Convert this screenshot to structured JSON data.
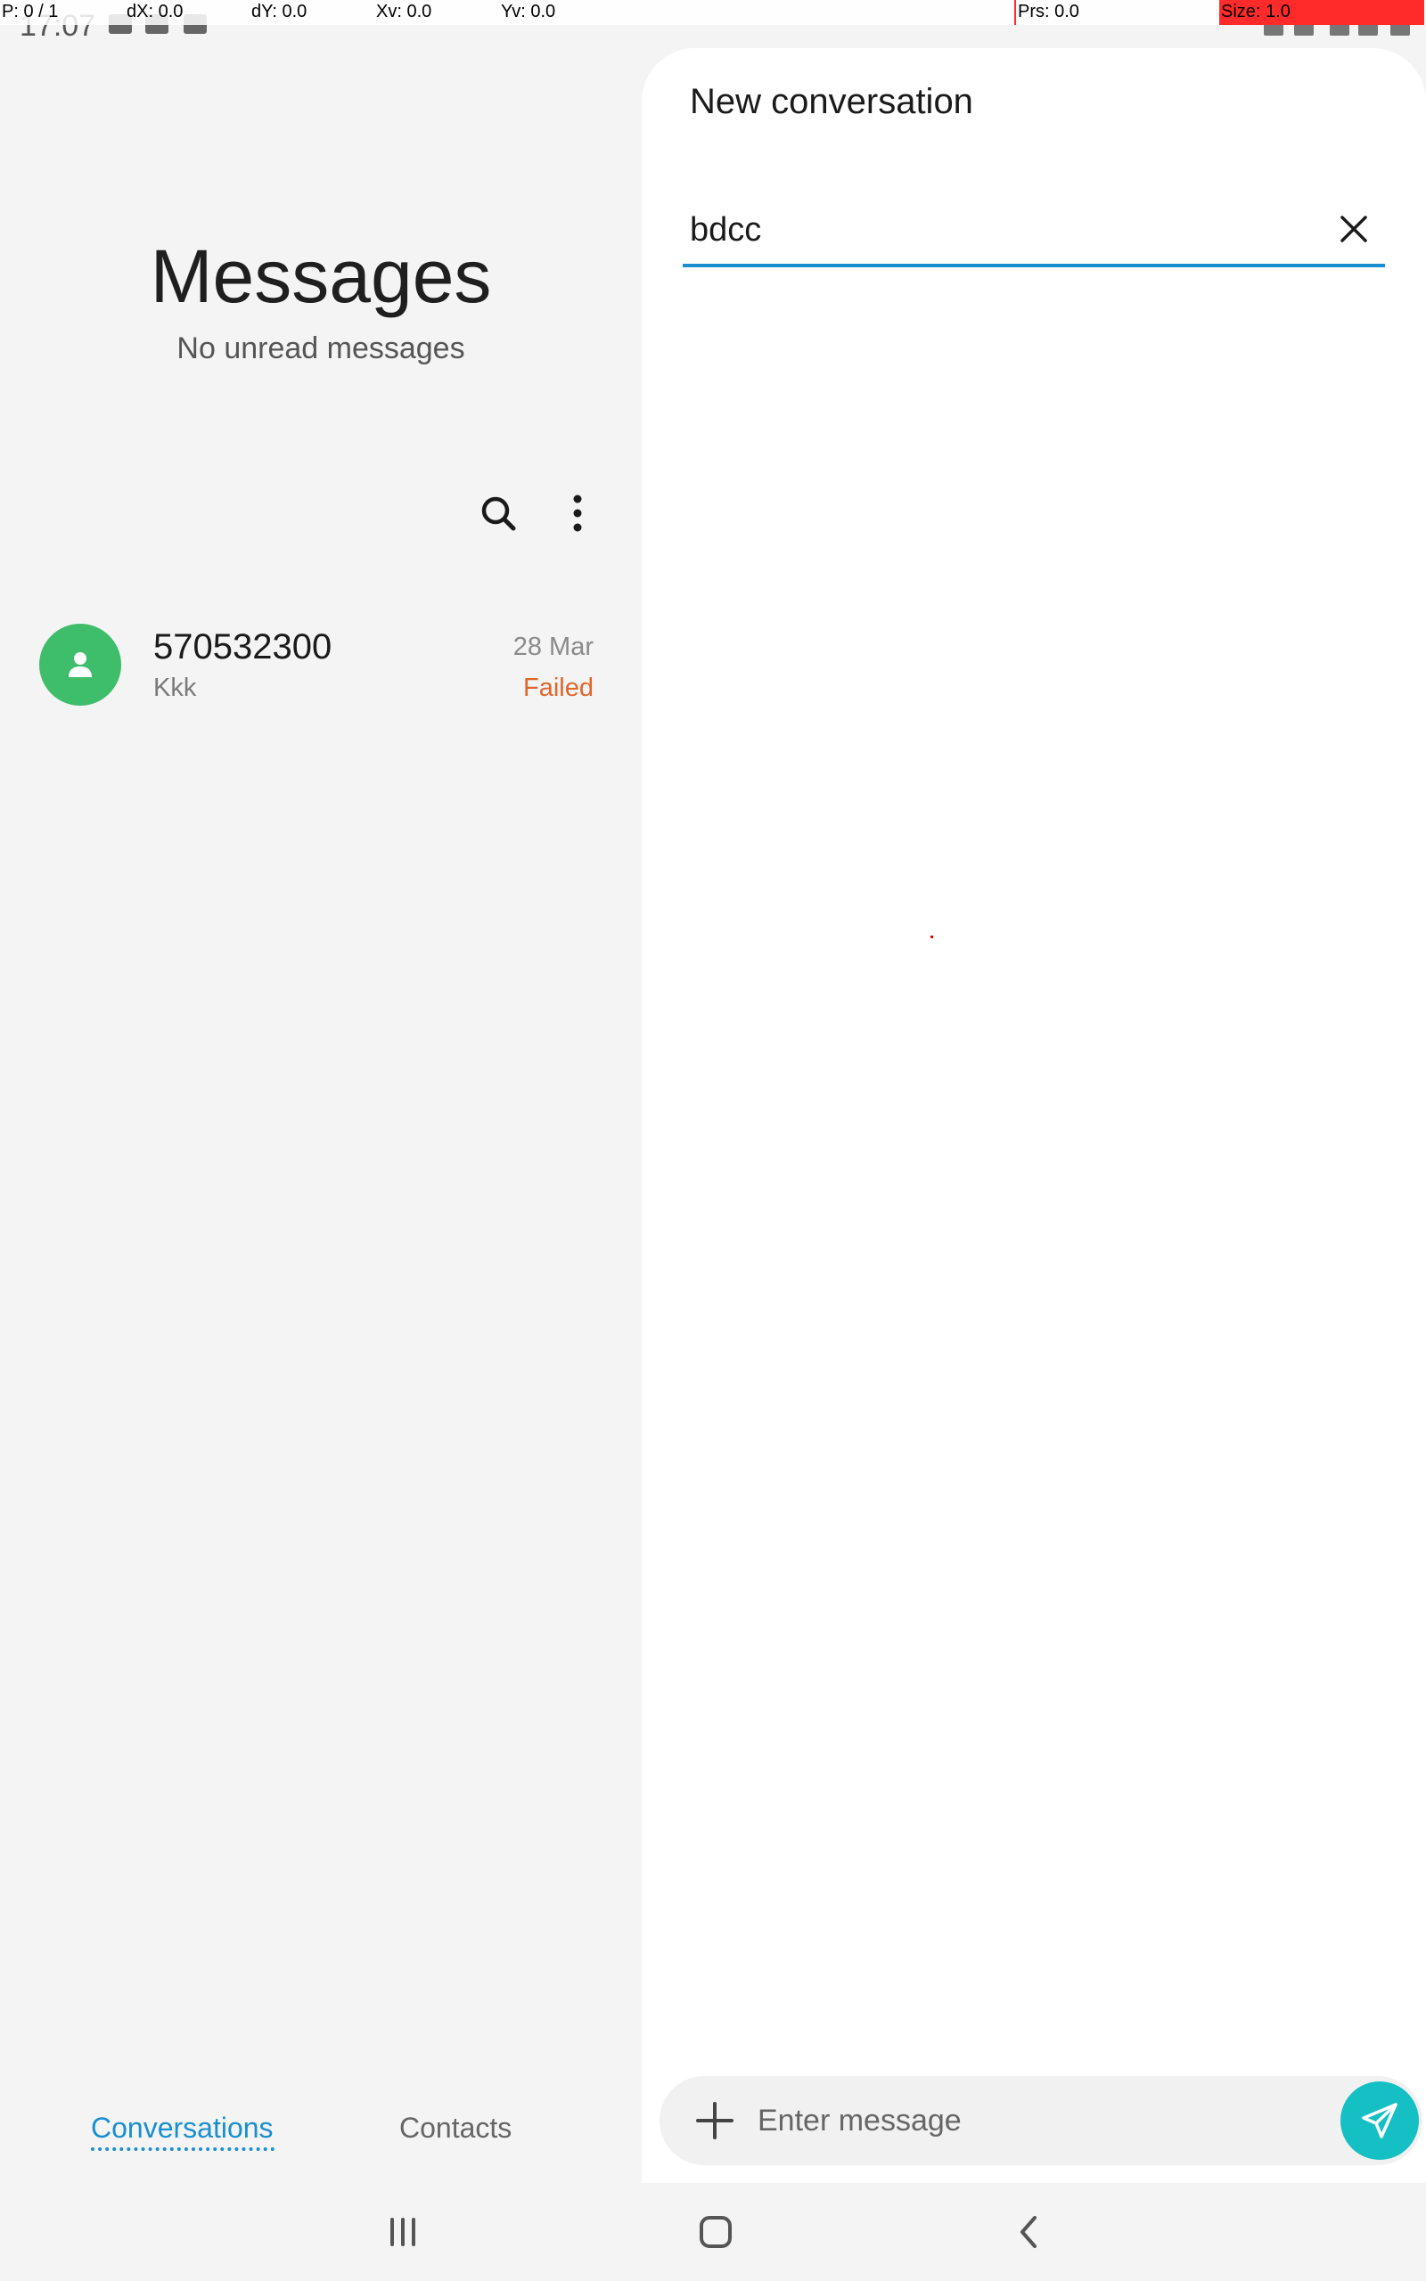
{
  "debug": {
    "pointer": "P: 0 / 1",
    "dx": "dX: 0.0",
    "dy": "dY: 0.0",
    "xv": "Xv: 0.0",
    "yv": "Yv: 0.0",
    "prs": "Prs: 0.0",
    "size": "Size: 1.0"
  },
  "status_bar": {
    "time": "17:07"
  },
  "main": {
    "title": "Messages",
    "subtitle": "No unread messages"
  },
  "conversations": [
    {
      "name": "570532300",
      "preview": "Kkk",
      "date": "28 Mar",
      "status": "Failed",
      "status_color": "#e0662b",
      "avatar_color": "#3ebd6a"
    }
  ],
  "tabs": {
    "conversations": "Conversations",
    "contacts": "Contacts"
  },
  "new_conversation": {
    "title": "New conversation",
    "recipient_value": "bdcc",
    "message_placeholder": "Enter message"
  },
  "colors": {
    "accent": "#1a8fd0",
    "send": "#14c0c4"
  }
}
